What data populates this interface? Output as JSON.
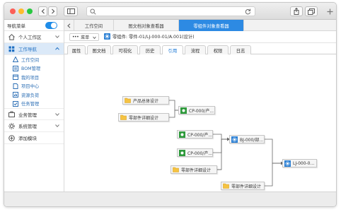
{
  "sidebar": {
    "nav_label": "导航菜单",
    "groups": [
      {
        "label": "个人工作区"
      },
      {
        "label": "工作导航"
      },
      {
        "label": "业务管理"
      },
      {
        "label": "系统管理"
      },
      {
        "label": "添加模块"
      }
    ],
    "items": [
      {
        "label": "工作空间"
      },
      {
        "label": "BOM管理"
      },
      {
        "label": "我的项目"
      },
      {
        "label": "项目中心"
      },
      {
        "label": "资源负荷"
      },
      {
        "label": "任务管理"
      }
    ]
  },
  "tabs": [
    {
      "label": "工作空间"
    },
    {
      "label": "图文档对象查看器"
    },
    {
      "label": "零组件对象查看器"
    }
  ],
  "toolbar": {
    "menu_label": "菜单",
    "part_label": "零组件: 零件-01/LJ-000-01/A.001(设计)"
  },
  "prop_tabs": [
    {
      "label": "属性"
    },
    {
      "label": "图文档"
    },
    {
      "label": "可视化"
    },
    {
      "label": "历史"
    },
    {
      "label": "引用"
    },
    {
      "label": "流程"
    },
    {
      "label": "权限"
    },
    {
      "label": "日志"
    }
  ],
  "graph": {
    "nodes": [
      {
        "label": "产品总体设计"
      },
      {
        "label": "零部件详细设计"
      },
      {
        "label": "CP-000/产..."
      },
      {
        "label": "CP-000/产..."
      },
      {
        "label": "CP-000/产..."
      },
      {
        "label": "零部件详细设计"
      },
      {
        "label": "BJ-000/部..."
      },
      {
        "label": "零部件详细设计"
      },
      {
        "label": "LJ-000-0..."
      }
    ]
  },
  "colors": {
    "accent": "#2d8ae3",
    "folder": "#f5c342",
    "doc": "#2f9a3c",
    "part": "#2a7fd4"
  }
}
